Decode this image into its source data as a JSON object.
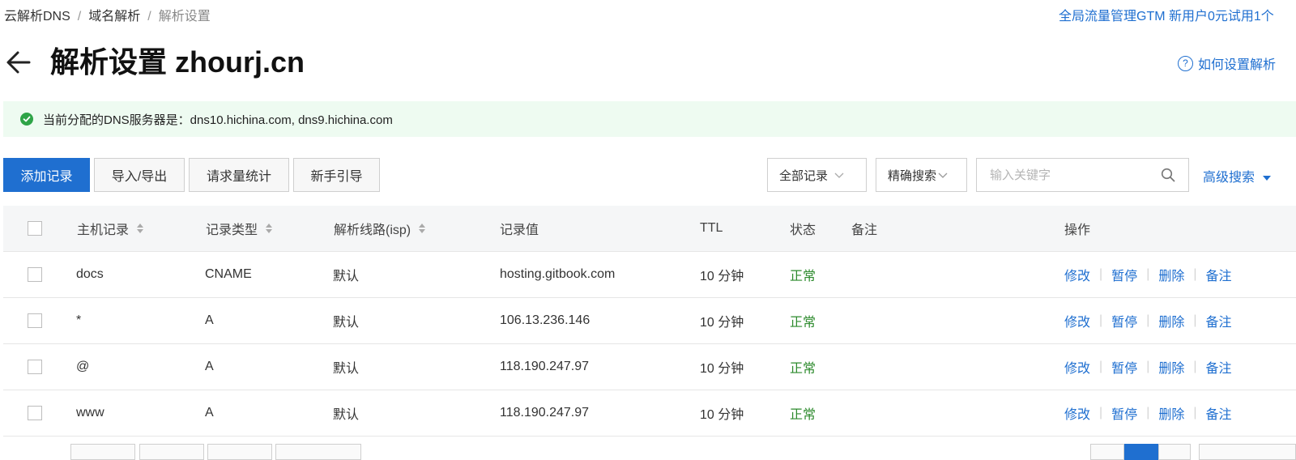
{
  "breadcrumb": {
    "items": [
      "云解析DNS",
      "域名解析",
      "解析设置"
    ],
    "separator": "/"
  },
  "promo": "全局流量管理GTM 新用户0元试用1个",
  "header": {
    "title": "解析设置 zhourj.cn",
    "help_link": "如何设置解析"
  },
  "notice": {
    "text": "当前分配的DNS服务器是：dns10.hichina.com, dns9.hichina.com"
  },
  "toolbar": {
    "add_label": "添加记录",
    "import_export_label": "导入/导出",
    "stats_label": "请求量统计",
    "guide_label": "新手引导",
    "filter_all": "全部记录",
    "match_mode": "精确搜索",
    "search_placeholder": "输入关键字",
    "advanced_label": "高级搜索"
  },
  "table": {
    "columns": [
      "主机记录",
      "记录类型",
      "解析线路(isp)",
      "记录值",
      "TTL",
      "状态",
      "备注",
      "操作"
    ],
    "rows": [
      {
        "host": "docs",
        "type": "CNAME",
        "line": "默认",
        "value": "hosting.gitbook.com",
        "ttl": "10 分钟",
        "status": "正常",
        "remark": ""
      },
      {
        "host": "*",
        "type": "A",
        "line": "默认",
        "value": "106.13.236.146",
        "ttl": "10 分钟",
        "status": "正常",
        "remark": ""
      },
      {
        "host": "@",
        "type": "A",
        "line": "默认",
        "value": "118.190.247.97",
        "ttl": "10 分钟",
        "status": "正常",
        "remark": ""
      },
      {
        "host": "www",
        "type": "A",
        "line": "默认",
        "value": "118.190.247.97",
        "ttl": "10 分钟",
        "status": "正常",
        "remark": ""
      }
    ],
    "actions": [
      "修改",
      "暂停",
      "删除",
      "备注"
    ]
  },
  "colors": {
    "primary": "#1f6fd0",
    "success": "#2ea447",
    "notice_bg": "#eefbf1"
  }
}
